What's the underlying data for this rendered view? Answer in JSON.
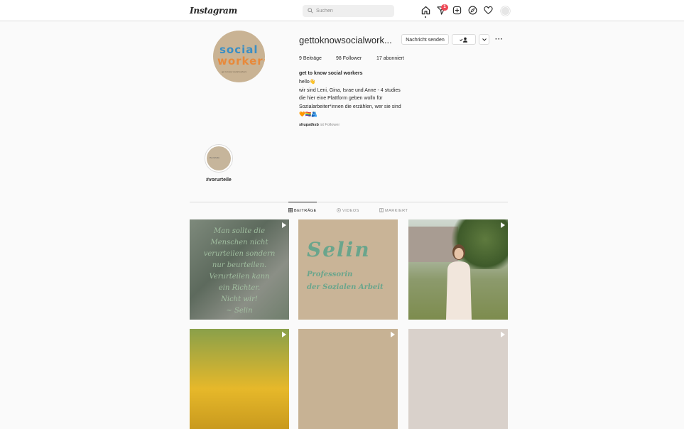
{
  "topbar": {
    "logo": "Instagram",
    "search_placeholder": "Suchen",
    "notification_count": "1"
  },
  "profile": {
    "avatar_line1": "social",
    "avatar_line2": "workers",
    "avatar_caption": "get to know social workers",
    "username": "gettoknowsocialwork...",
    "message_button": "Nachricht senden",
    "follow_icon": "person-check-icon",
    "more_label": "···",
    "stats": [
      {
        "count": "9",
        "label": "Beiträge"
      },
      {
        "count": "98",
        "label": "Follower"
      },
      {
        "count": "17",
        "label": "abonniert"
      }
    ],
    "full_name": "get to know social workers",
    "bio": [
      "hello👋",
      "wir sind Leni, Gina, Israe und Anne - 4 studies",
      "die hier eine Plattform geben wolln für",
      "Sozialarbeiter*innen die erzählen, wer sie sind",
      "🧡🏳️‍🌈🫂"
    ],
    "followed_by_user": "shupathsb",
    "followed_by_suffix": "ist Follower"
  },
  "highlights": [
    {
      "label": "#vorurteile",
      "cover_text": "#vorurteile"
    }
  ],
  "tabs": [
    {
      "label": "BEITRÄGE",
      "icon": "grid-icon",
      "active": true
    },
    {
      "label": "VIDEOS",
      "icon": "video-icon",
      "active": false
    },
    {
      "label": "MARKIERT",
      "icon": "tag-icon",
      "active": false
    }
  ],
  "posts": {
    "quote_lines": [
      "Man sollte die",
      "Menschen nicht",
      "verurteilen sondern",
      "nur beurteilen.",
      "Verurteilen kann",
      "ein Richter.",
      "Nicht wir!",
      "~ Selin"
    ],
    "intro_name": "Selin",
    "intro_sub1": "Professorin",
    "intro_sub2": "der Sozialen Arbeit"
  },
  "colors": {
    "accent_badge": "#ed4956",
    "avatar_bg": "#c9b394",
    "post_text_green": "#6aa58c"
  }
}
